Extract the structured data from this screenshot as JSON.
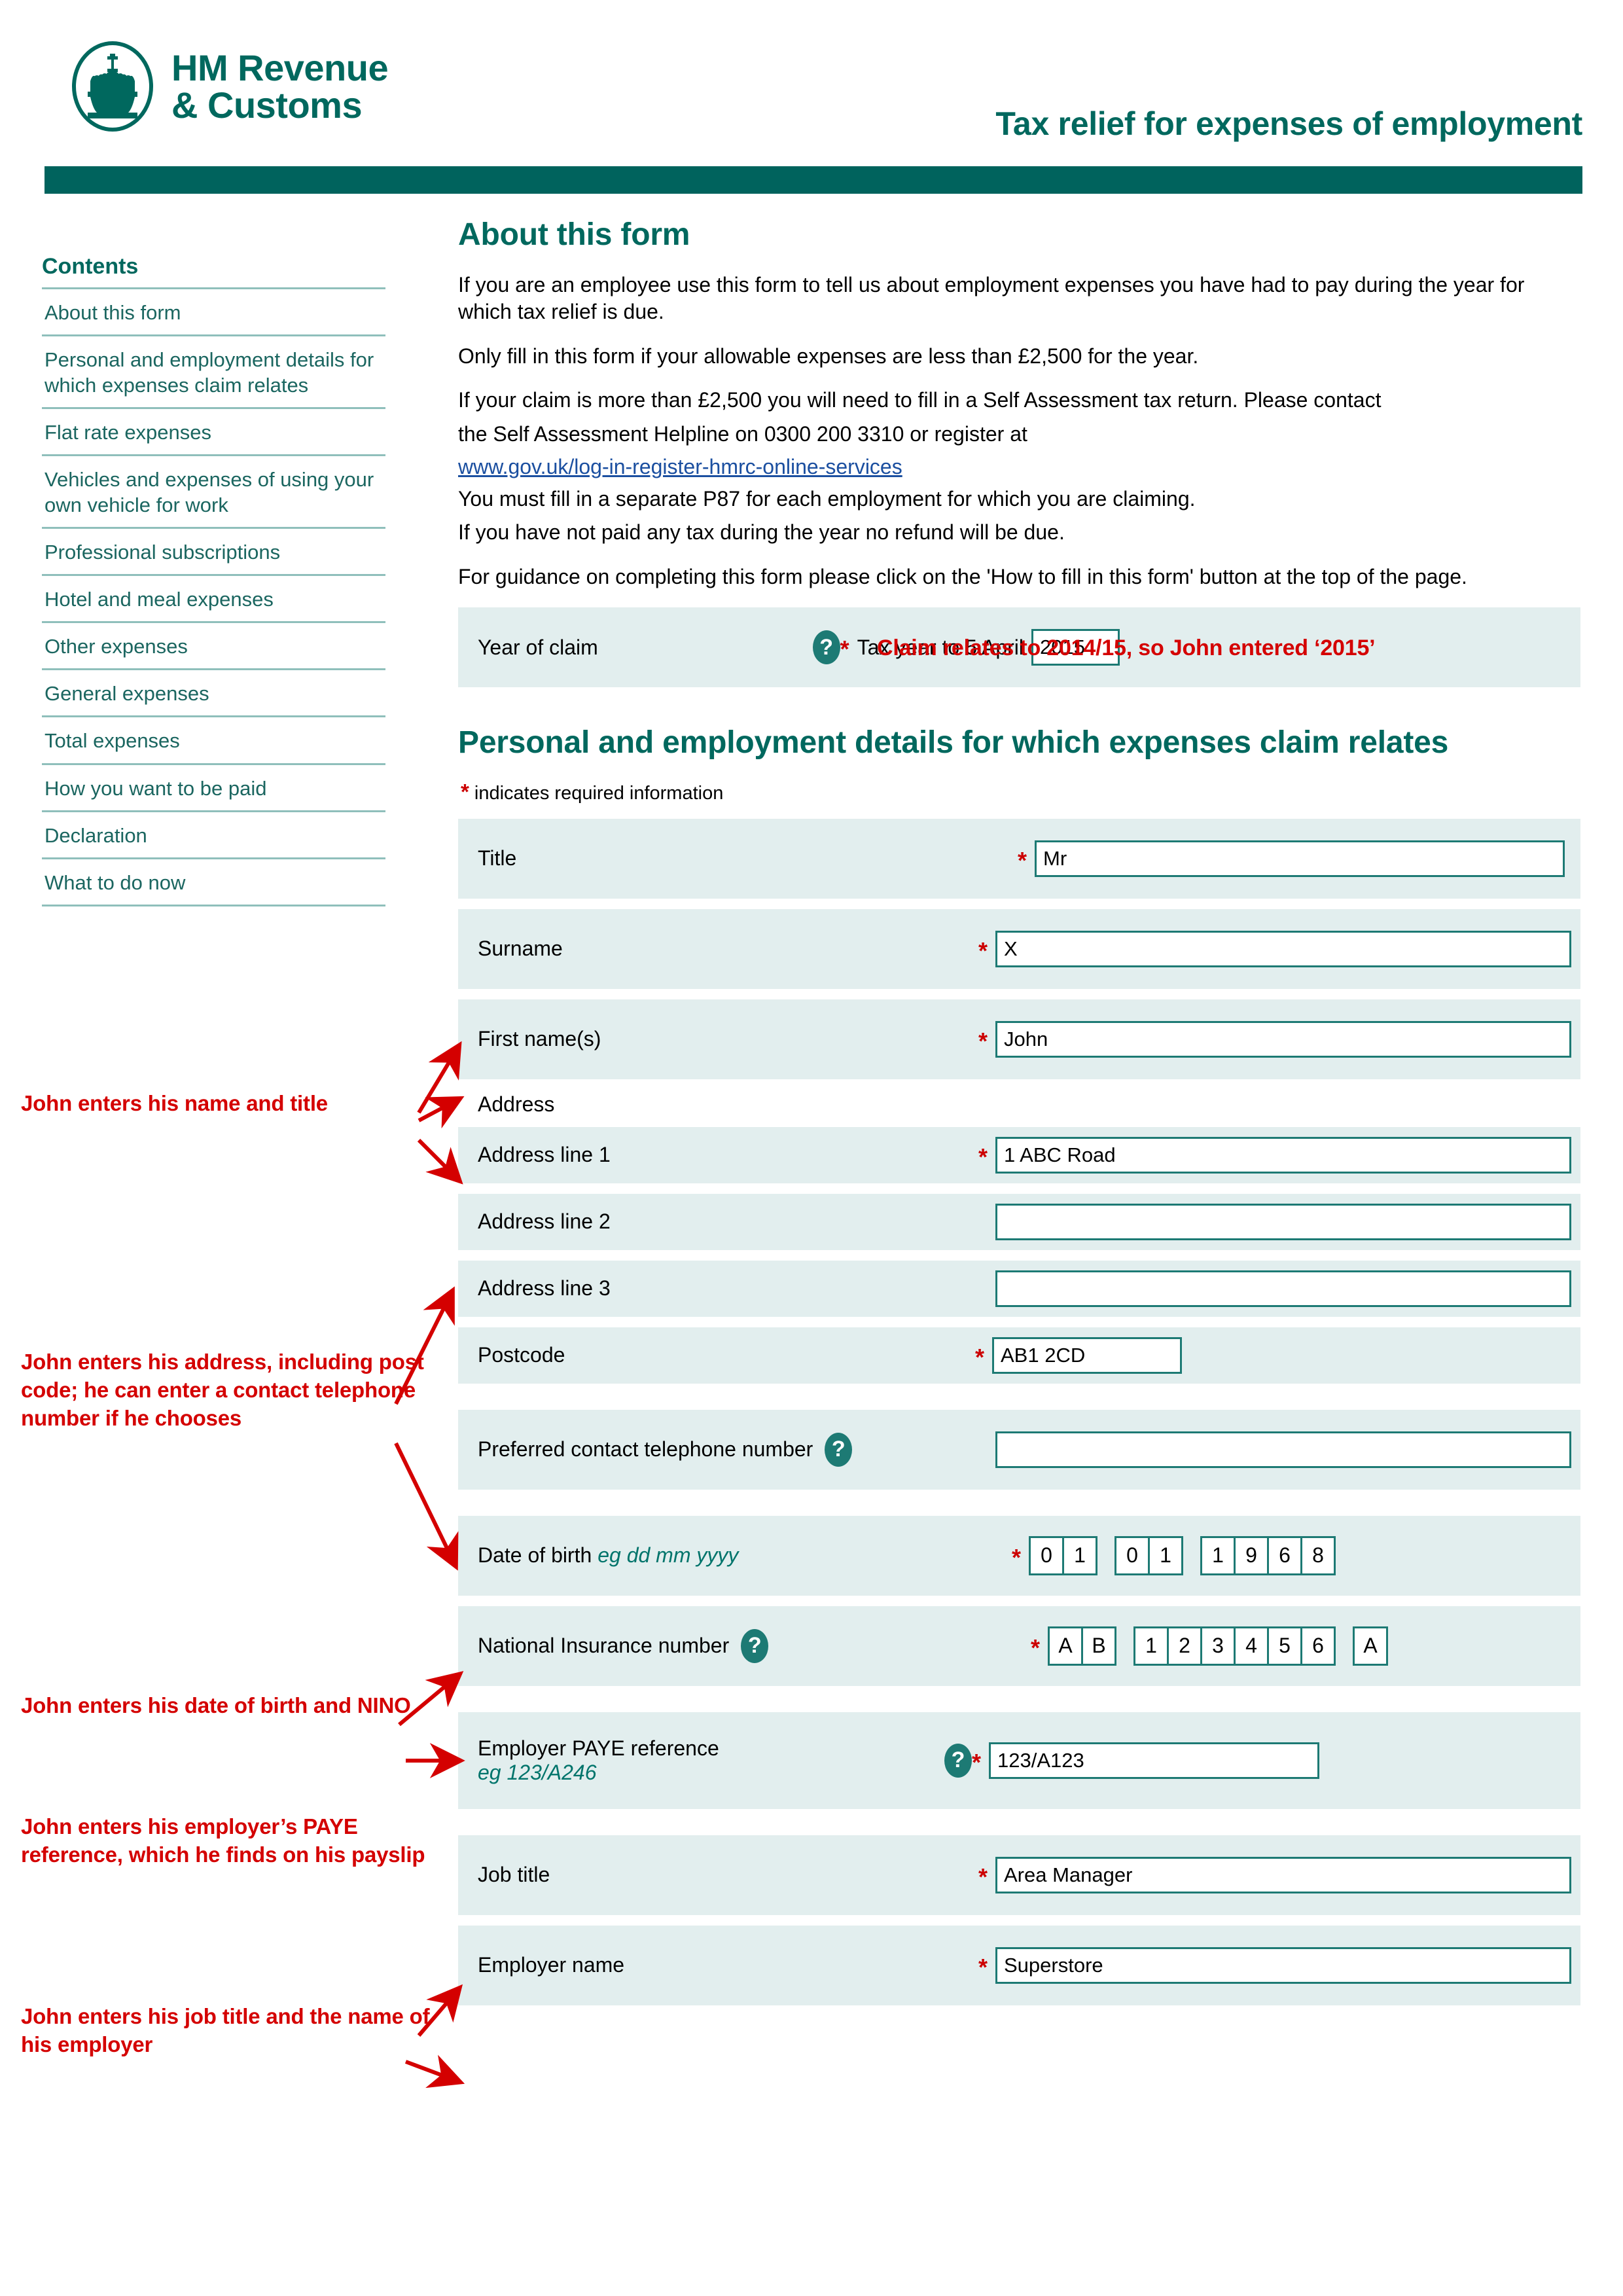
{
  "brand": {
    "logo_line1": "HM Revenue",
    "logo_line2": "& Customs",
    "accent_teal": "#00685E",
    "bar_teal": "#00635D",
    "row_bg": "#e2eeee",
    "annotation_red": "#d40000",
    "required_red": "#cc0000",
    "link_blue": "#1b4fa0"
  },
  "header": {
    "title": "Tax relief for expenses of employment"
  },
  "sidebar": {
    "heading": "Contents",
    "items": [
      {
        "label": "About this form"
      },
      {
        "label": "Personal and employment details for which expenses claim relates"
      },
      {
        "label": "Flat rate expenses"
      },
      {
        "label": "Vehicles and expenses of using your own vehicle for work"
      },
      {
        "label": "Professional subscriptions"
      },
      {
        "label": "Hotel and meal expenses"
      },
      {
        "label": "Other expenses"
      },
      {
        "label": "General expenses"
      },
      {
        "label": "Total expenses"
      },
      {
        "label": "How you want to be paid"
      },
      {
        "label": "Declaration"
      },
      {
        "label": "What to do now"
      }
    ]
  },
  "about": {
    "heading": "About this form",
    "p1": "If you are an employee use this form to tell us about employment expenses you have had to pay during the year for which tax relief is due.",
    "p2": "Only fill in this form if your allowable expenses are less than £2,500 for the year.",
    "p3": "If your claim is more than £2,500 you will need to fill in a Self Assessment tax return. Please contact",
    "p4": " the Self Assessment Helpline on 0300 200 3310 or register at",
    "link": "www.gov.uk/log-in-register-hmrc-online-services",
    "p5": "You must fill in a separate P87 for each employment for which you are claiming.",
    "p6": "If you have not paid any tax during the year no refund will be due.",
    "p7": "For guidance on completing this form please click on the 'How to fill in this form' button at the top of the page."
  },
  "year_of_claim": {
    "label": "Year of claim",
    "help_icon": "question-mark-icon",
    "required_marker": "*",
    "inline_label": "Tax year to 5 April",
    "value": "2015"
  },
  "personal": {
    "heading": "Personal and employment details for which expenses claim relates",
    "required_note_star": "*",
    "required_note_text": "indicates required information",
    "title_label": "Title",
    "title_value": "Mr",
    "surname_label": "Surname",
    "surname_value": "X",
    "firstname_label": "First name(s)",
    "firstname_value": "John",
    "address_caption": "Address",
    "address1_label": "Address line 1",
    "address1_value": "1 ABC Road",
    "address2_label": "Address line 2",
    "address2_value": "",
    "address3_label": "Address line 3",
    "address3_value": "",
    "postcode_label": "Postcode",
    "postcode_value": "AB1 2CD",
    "phone_label": "Preferred contact telephone number",
    "phone_value": "",
    "dob_label": "Date of birth",
    "dob_hint": "eg dd mm yyyy",
    "dob_day": [
      "0",
      "1"
    ],
    "dob_month": [
      "0",
      "1"
    ],
    "dob_year": [
      "1",
      "9",
      "6",
      "8"
    ],
    "nino_label": "National Insurance number",
    "nino_prefix": [
      "A",
      "B"
    ],
    "nino_digits": [
      "1",
      "2",
      "3",
      "4",
      "5",
      "6"
    ],
    "nino_suffix": [
      "A"
    ],
    "paye_label": "Employer PAYE reference",
    "paye_hint": "eg 123/A246",
    "paye_value": "123/A123",
    "jobtitle_label": "Job title",
    "jobtitle_value": "Area Manager",
    "employer_label": "Employer name",
    "employer_value": "Superstore"
  },
  "annotations": {
    "year": "Claim relates to 2014/15, so John entered ‘2015’",
    "name": "John enters his name and title",
    "address": "John enters his address, including post code; he can enter a contact telephone number if he chooses",
    "dob": "John enters his date of birth and NINO",
    "paye": "John enters his employer’s PAYE reference, which he finds on his payslip",
    "job": "John enters his job title and the name of his employer"
  }
}
